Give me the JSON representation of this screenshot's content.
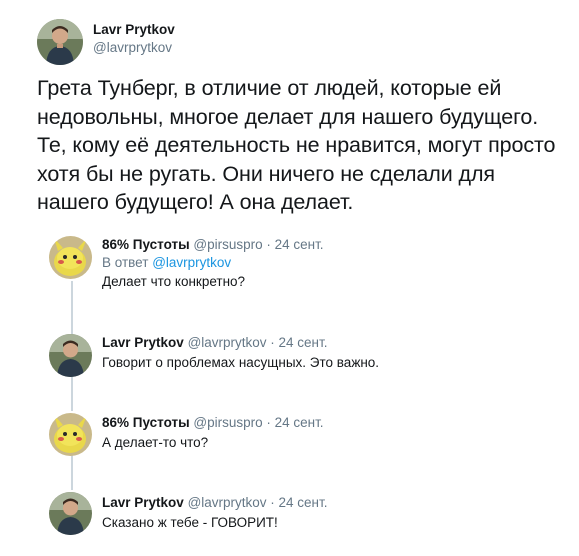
{
  "main_tweet": {
    "name": "Lavr Prytkov",
    "handle": "@lavrprytkov",
    "text": "Грета Тунберг, в отличие от людей, которые ей недовольны, многое делает для нашего будущего. Те, кому её деятельность не нравится, могут просто хотя бы не ругать. Они ничего не сделали для нашего будущего! А она делает."
  },
  "replies": [
    {
      "name": "86% Пустоты",
      "meta": "@pirsuspro · 24 сент.",
      "reply_to_prefix": "В ответ",
      "reply_to_handle": "@lavrprytkov",
      "text": "Делает что конкретно?"
    },
    {
      "name": "Lavr Prytkov",
      "meta": "@lavrprytkov · 24 сент.",
      "text": "Говорит о проблемах насущных. Это важно."
    },
    {
      "name": "86% Пустоты",
      "meta": "@pirsuspro · 24 сент.",
      "text": "А делает-то что?"
    },
    {
      "name": "Lavr Prytkov",
      "meta": "@lavrprytkov · 24 сент.",
      "text": "Сказано ж  тебе - ГОВОРИТ!"
    }
  ],
  "colors": {
    "link": "#1b95e0",
    "secondary": "#657786",
    "thread_line": "#ccd6dd"
  }
}
